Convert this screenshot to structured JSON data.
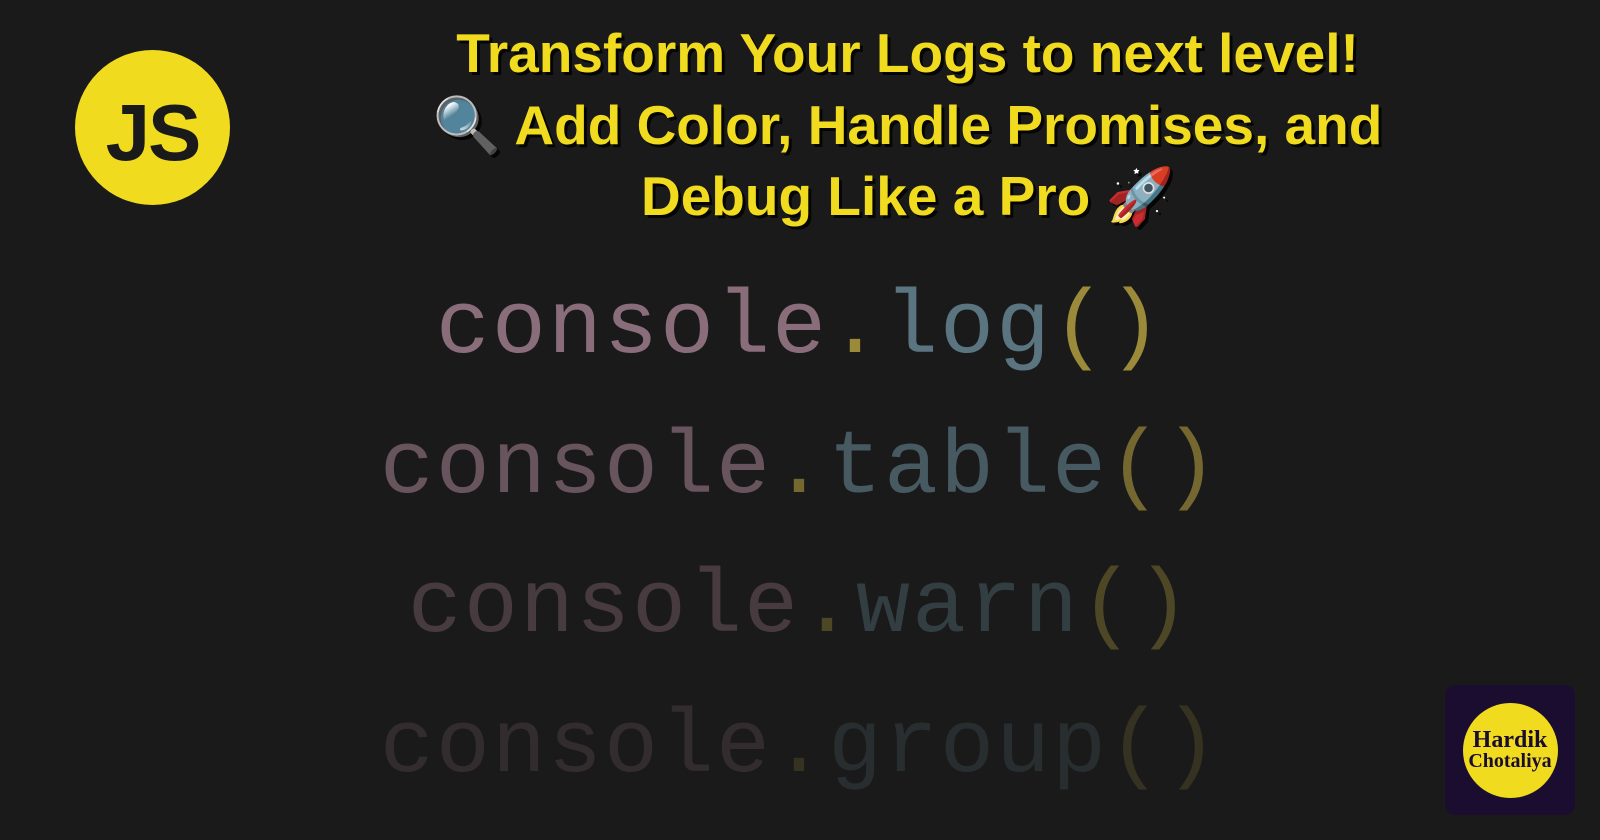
{
  "badge": {
    "text": "JS"
  },
  "title": {
    "line1": "Transform Your Logs to next level!",
    "line2a": "🔍 Add Color, Handle Promises, and",
    "line3a": "Debug Like a Pro 🚀"
  },
  "code": [
    {
      "obj": "console",
      "dot": ".",
      "method": "log",
      "paren": "()",
      "fadeClass": ""
    },
    {
      "obj": "console",
      "dot": ".",
      "method": "table",
      "paren": "()",
      "fadeClass": "fade-2"
    },
    {
      "obj": "console",
      "dot": ".",
      "method": "warn",
      "paren": "()",
      "fadeClass": "fade-3"
    },
    {
      "obj": "console",
      "dot": ".",
      "method": "group",
      "paren": "()",
      "fadeClass": "fade-4"
    }
  ],
  "author": {
    "name1": "Hardik",
    "name2": "Chotaliya"
  },
  "colors": {
    "background": "#1a1a1a",
    "accent": "#f0db1e",
    "code_obj": "#8a6d7a",
    "code_method": "#5a7580",
    "code_punct": "#9a8a3a"
  }
}
